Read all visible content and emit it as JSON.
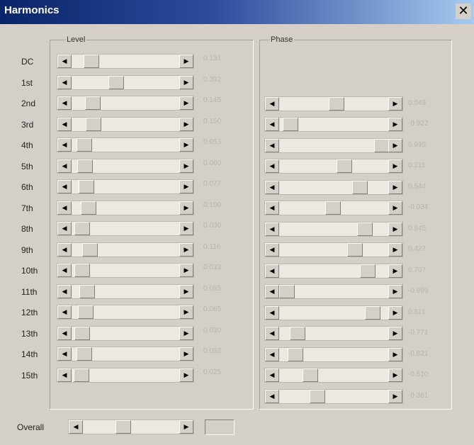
{
  "window": {
    "title": "Harmonics",
    "close_glyph": "✕"
  },
  "groups": {
    "level_label": "Level",
    "phase_label": "Phase"
  },
  "arrows": {
    "left": "◀",
    "right": "▶"
  },
  "harmonics": [
    {
      "label": "DC",
      "level": 0.131,
      "level_text": "0.131",
      "phase": null,
      "phase_text": ""
    },
    {
      "label": "1st",
      "level": 0.392,
      "level_text": "0.392",
      "phase": 0.049,
      "phase_text": "0.049"
    },
    {
      "label": "2nd",
      "level": 0.145,
      "level_text": "0.145",
      "phase": -0.922,
      "phase_text": "-0.922"
    },
    {
      "label": "3rd",
      "level": 0.15,
      "level_text": "0.150",
      "phase": 0.995,
      "phase_text": "0.995"
    },
    {
      "label": "4th",
      "level": 0.053,
      "level_text": "0.053",
      "phase": 0.211,
      "phase_text": "0.211"
    },
    {
      "label": "5th",
      "level": 0.06,
      "level_text": "0.060",
      "phase": 0.544,
      "phase_text": "0.544"
    },
    {
      "label": "6th",
      "level": 0.077,
      "level_text": "0.077",
      "phase": -0.034,
      "phase_text": "-0.034"
    },
    {
      "label": "7th",
      "level": 0.1,
      "level_text": "0.100",
      "phase": 0.645,
      "phase_text": "0.645"
    },
    {
      "label": "8th",
      "level": 0.03,
      "level_text": "0.030",
      "phase": 0.427,
      "phase_text": "0.427"
    },
    {
      "label": "9th",
      "level": 0.116,
      "level_text": "0.116",
      "phase": 0.707,
      "phase_text": "0.707"
    },
    {
      "label": "10th",
      "level": 0.033,
      "level_text": "0.033",
      "phase": -0.999,
      "phase_text": "-0.999"
    },
    {
      "label": "11th",
      "level": 0.085,
      "level_text": "0.085",
      "phase": 0.811,
      "phase_text": "0.811"
    },
    {
      "label": "12th",
      "level": 0.065,
      "level_text": "0.065",
      "phase": -0.771,
      "phase_text": "-0.771"
    },
    {
      "label": "13th",
      "level": 0.03,
      "level_text": "0.030",
      "phase": -0.821,
      "phase_text": "-0.821"
    },
    {
      "label": "14th",
      "level": 0.052,
      "level_text": "0.052",
      "phase": -0.51,
      "phase_text": "-0.510"
    },
    {
      "label": "15th",
      "level": 0.025,
      "level_text": "0.025",
      "phase": -0.361,
      "phase_text": "-0.361"
    }
  ],
  "overall": {
    "label": "Overall",
    "value": 0.4,
    "value_text": ""
  }
}
